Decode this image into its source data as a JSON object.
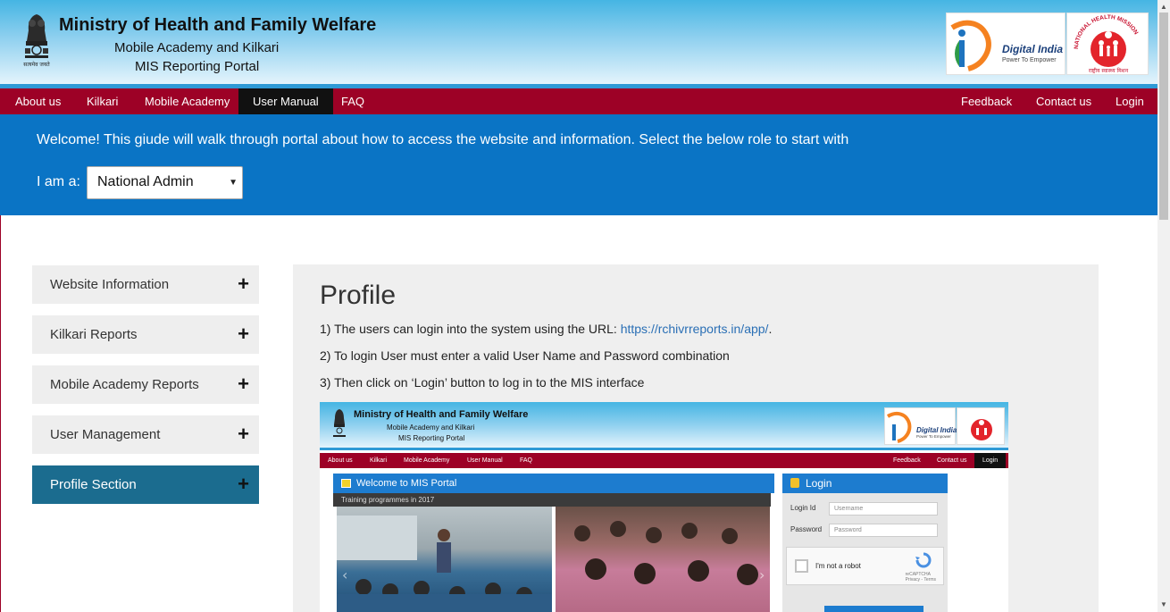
{
  "header": {
    "title": "Ministry of Health and Family Welfare",
    "subtitle1": "Mobile Academy and Kilkari",
    "subtitle2": "MIS Reporting Portal",
    "emblem_caption": "सत्यमेव जयते",
    "digital_india": {
      "name": "Digital India",
      "tagline": "Power To Empower"
    },
    "nhm": {
      "name": "NATIONAL HEALTH MISSION",
      "hindi": "राष्ट्रीय स्वास्थ्य मिशन"
    }
  },
  "nav": {
    "left": [
      "About us",
      "Kilkari",
      "Mobile Academy",
      "User Manual",
      "FAQ"
    ],
    "active": "User Manual",
    "right": [
      "Feedback",
      "Contact us",
      "Login"
    ]
  },
  "welcome": {
    "text": "Welcome! This giude will walk through portal about how to access the website and information. Select the below role to start with",
    "role_label": "I am a:",
    "role_value": "National Admin"
  },
  "sidebar": {
    "items": [
      {
        "label": "Website Information",
        "icon": "+"
      },
      {
        "label": "Kilkari Reports",
        "icon": "+"
      },
      {
        "label": "Mobile Academy Reports",
        "icon": "+"
      },
      {
        "label": "User Management",
        "icon": "+"
      },
      {
        "label": "Profile Section",
        "icon": "+",
        "active": true
      }
    ]
  },
  "content": {
    "heading": "Profile",
    "step1_prefix": "1) The users can login into the system using the URL: ",
    "step1_link": "https://rchivrreports.in/app/",
    "step1_suffix": ".",
    "step2": "2) To login User must enter a valid User Name and Password combination",
    "step3": "3) Then click on ‘Login’ button to log in to the MIS interface"
  },
  "screenshot": {
    "title": "Ministry of Health and Family Welfare",
    "subtitle1": "Mobile Academy and Kilkari",
    "subtitle2": "MIS Reporting Portal",
    "digital_india": "Digital India",
    "digital_india_tag": "Power To Empower",
    "nav_left": [
      "About us",
      "Kilkari",
      "Mobile Academy",
      "User Manual",
      "FAQ"
    ],
    "nav_right": [
      "Feedback",
      "Contact us",
      "Login"
    ],
    "portal_title": "Welcome to MIS Portal",
    "caption": "Training programmes in 2017",
    "login_title": "Login",
    "login_id_label": "Login Id",
    "login_id_placeholder": "Username",
    "password_label": "Password",
    "password_placeholder": "Password",
    "robot_text": "I'm not a robot",
    "recaptcha": "reCAPTCHA",
    "recaptcha_terms": "Privacy - Terms"
  },
  "colors": {
    "nav_bg": "#9d0126",
    "welcome_bg": "#0a74c5",
    "sidebar_active": "#1b6c8f",
    "link": "#2a6fb5"
  }
}
